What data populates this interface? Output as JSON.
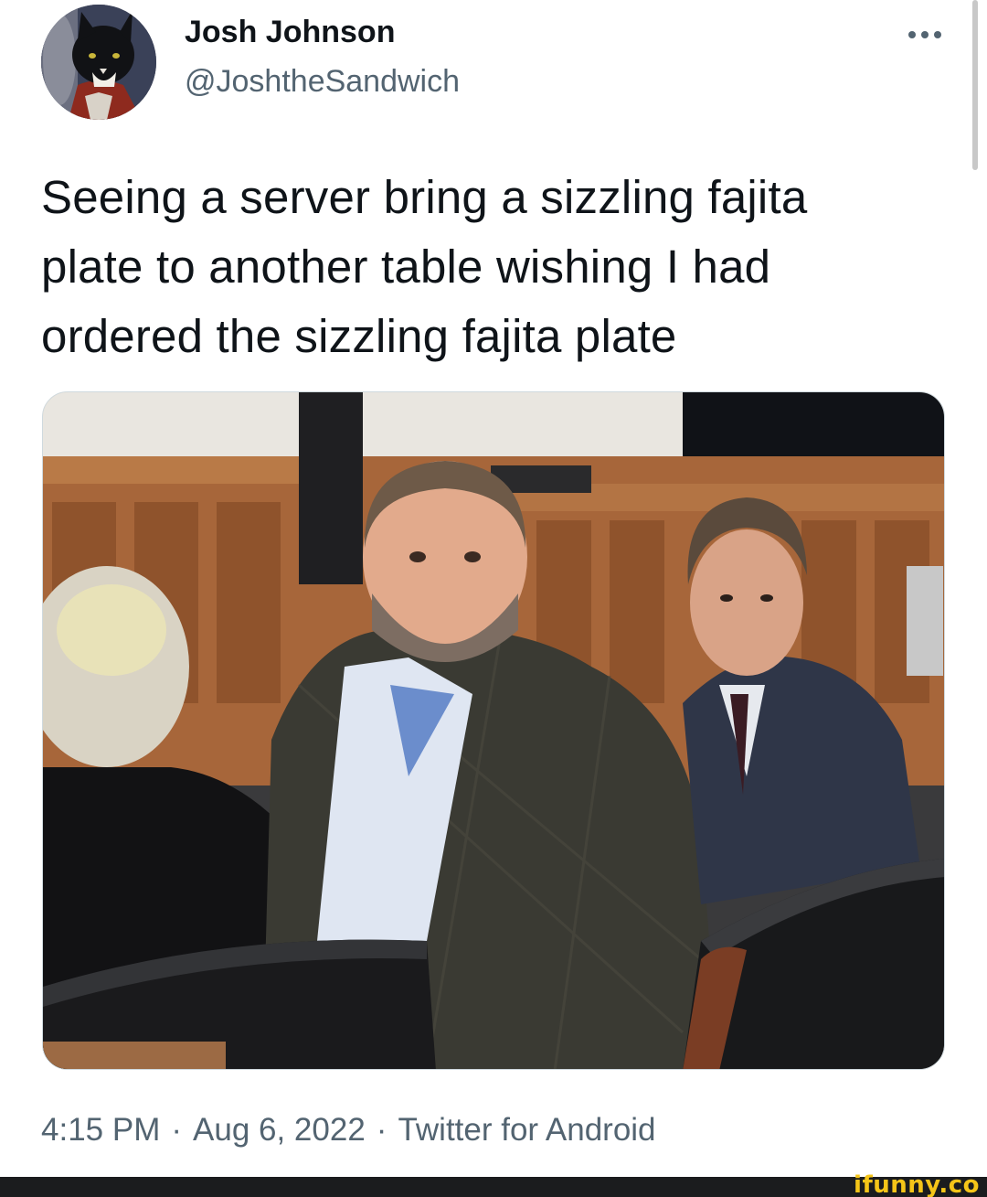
{
  "author": {
    "display_name": "Josh Johnson",
    "handle": "@JoshtheSandwich",
    "avatar_icon": "cat-avatar"
  },
  "more_icon": "more-horizontal-icon",
  "tweet": {
    "lines": [
      "Seeing a server bring a sizzling fajita",
      "plate to another table wishing I had",
      "ordered the sizzling fajita plate"
    ]
  },
  "media": {
    "type": "photo"
  },
  "meta": {
    "time": "4:15 PM",
    "separator": "·",
    "date": "Aug 6, 2022",
    "source": "Twitter for Android"
  },
  "watermark": {
    "text": "ifunny.co"
  },
  "colors": {
    "text_primary": "#0f1419",
    "text_secondary": "#536471",
    "watermark": "#f5c518",
    "footer": "#1b1c1e"
  }
}
